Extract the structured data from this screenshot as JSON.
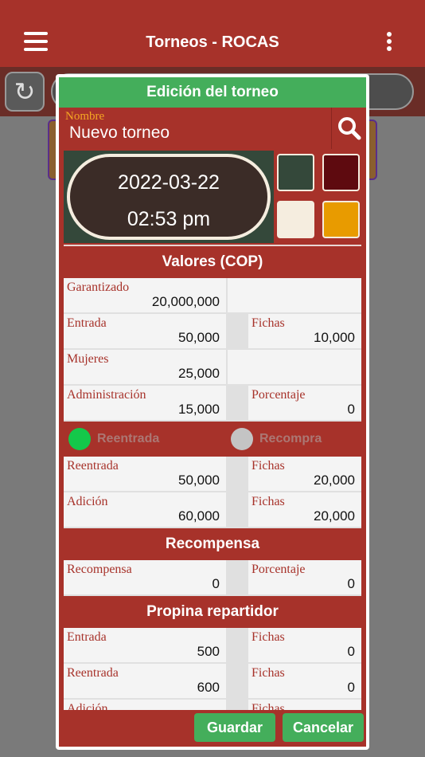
{
  "appbar": {
    "title": "Torneos - ROCAS"
  },
  "dialog": {
    "title": "Edición del torneo",
    "name": {
      "label": "Nombre",
      "value": "Nuevo torneo"
    },
    "date": "2022-03-22",
    "time": "02:53 pm",
    "colors": [
      "#34483a",
      "#5e0a0f",
      "#f5eddf",
      "#e89b00"
    ],
    "sections": {
      "valores": "Valores (COP)",
      "recompensa": "Recompensa",
      "propina": "Propina repartidor"
    },
    "valores": {
      "garantizado": {
        "label": "Garantizado",
        "value": "20,000,000"
      },
      "entrada": {
        "label": "Entrada",
        "value": "50,000"
      },
      "entrada_fichas": {
        "label": "Fichas",
        "value": "10,000"
      },
      "mujeres": {
        "label": "Mujeres",
        "value": "25,000"
      },
      "administracion": {
        "label": "Administración",
        "value": "15,000"
      },
      "porcentaje": {
        "label": "Porcentaje",
        "value": "0"
      }
    },
    "toggles": {
      "reentrada": "Reentrada",
      "recompra": "Recompra"
    },
    "reentrada": {
      "reentrada": {
        "label": "Reentrada",
        "value": "50,000"
      },
      "reentrada_fichas": {
        "label": "Fichas",
        "value": "20,000"
      },
      "adicion": {
        "label": "Adición",
        "value": "60,000"
      },
      "adicion_fichas": {
        "label": "Fichas",
        "value": "20,000"
      }
    },
    "recompensa": {
      "recompensa": {
        "label": "Recompensa",
        "value": "0"
      },
      "porcentaje": {
        "label": "Porcentaje",
        "value": "0"
      }
    },
    "propina": {
      "entrada": {
        "label": "Entrada",
        "value": "500"
      },
      "entrada_fichas": {
        "label": "Fichas",
        "value": "0"
      },
      "reentrada": {
        "label": "Reentrada",
        "value": "600"
      },
      "reentrada_fichas": {
        "label": "Fichas",
        "value": "0"
      },
      "adicion": {
        "label": "Adición"
      },
      "adicion_fichas": {
        "label": "Fichas"
      }
    },
    "buttons": {
      "save": "Guardar",
      "cancel": "Cancelar"
    }
  },
  "icons": [
    "menu-icon",
    "more-vert-icon",
    "refresh-icon",
    "search-icon"
  ]
}
